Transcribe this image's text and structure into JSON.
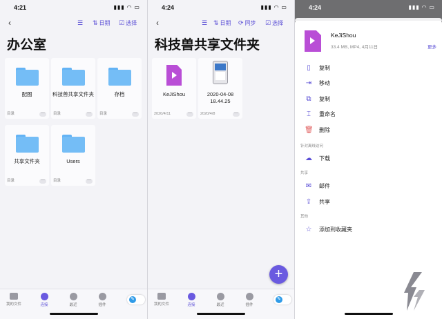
{
  "panel1": {
    "time": "4:21",
    "status_icons": "▮▮▮ ◠ ▭",
    "nav": {
      "back": "‹",
      "list_icon": "☰",
      "date": "日期",
      "select": "选择"
    },
    "title": "办公室",
    "tiles": [
      {
        "name": "配图",
        "meta": "目录"
      },
      {
        "name": "科技兽共享文件夹",
        "meta": "目录"
      },
      {
        "name": "存档",
        "meta": "目录"
      },
      {
        "name": "共享文件夹",
        "meta": "目录"
      },
      {
        "name": "Users",
        "meta": "目录"
      }
    ]
  },
  "panel2": {
    "time": "4:24",
    "status_icons": "▮▮▮ ◠ ▭",
    "nav": {
      "back": "‹",
      "list_icon": "☰",
      "date": "日期",
      "sync": "同步",
      "select": "选择"
    },
    "title": "科技兽共享文件夹",
    "tiles": [
      {
        "name": "KeJiShou",
        "meta": "2020/4/11"
      },
      {
        "name": "2020-04-08 18.44.25",
        "meta": "2020/4/8"
      }
    ],
    "fab": "+"
  },
  "tabbar": {
    "items": [
      "我的文件",
      "连接",
      "最近",
      "插件"
    ],
    "more": "···"
  },
  "panel3": {
    "time": "4:24",
    "status_icons": "▮▮▮ ◠ ▭",
    "file": {
      "name": "KeJiShou",
      "meta": "33.4 MB, MP4, 4月11日",
      "more": "更多"
    },
    "actions": [
      {
        "icon": "▯",
        "label": "复制"
      },
      {
        "icon": "⇥",
        "label": "移动"
      },
      {
        "icon": "⧉",
        "label": "复制"
      },
      {
        "icon": "⌶",
        "label": "重命名"
      },
      {
        "icon": "🗑",
        "label": "删除"
      }
    ],
    "section_offline": "针对离线访问",
    "download": {
      "icon": "☁",
      "label": "下载"
    },
    "section_share": "共享",
    "share_actions": [
      {
        "icon": "✉",
        "label": "邮件"
      },
      {
        "icon": "⇪",
        "label": "共享"
      }
    ],
    "section_other": "其他",
    "favorite": {
      "icon": "☆",
      "label": "添加到收藏夹"
    }
  },
  "colors": {
    "accent": "#6a5ae0",
    "folder": "#74bdf6",
    "video": "#b94ed6",
    "delete": "#e05a5a"
  }
}
